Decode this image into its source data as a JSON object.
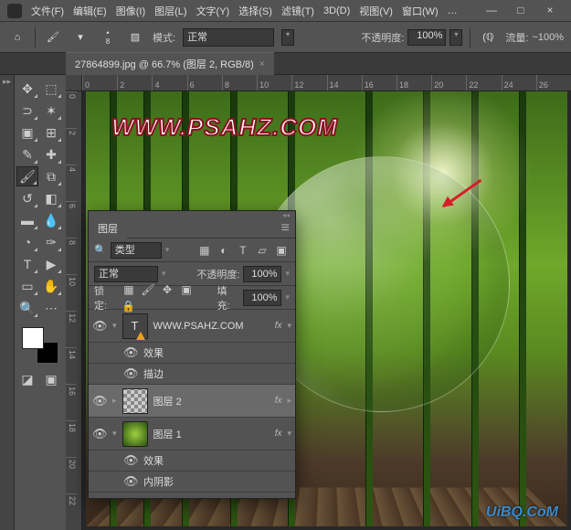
{
  "menu": {
    "file": "文件(F)",
    "edit": "编辑(E)",
    "image": "图像(I)",
    "layer": "图层(L)",
    "type": "文字(Y)",
    "select": "选择(S)",
    "filter": "滤镜(T)",
    "threeD": "3D(D)",
    "view": "视图(V)",
    "window": "窗口(W)",
    "help_truncated": "…"
  },
  "optbar": {
    "brush_size": "8",
    "mode_label": "模式:",
    "mode_value": "正常",
    "opacity_label": "不透明度:",
    "opacity_value": "100%",
    "flow_label": "流量:",
    "flow_value": "~100%"
  },
  "doc_tab": {
    "title": "27864899.jpg @ 66.7% (图层 2, RGB/8)",
    "close": "×"
  },
  "ruler_h": [
    "0",
    "2",
    "4",
    "6",
    "8",
    "10",
    "12",
    "14",
    "16",
    "18",
    "20",
    "22",
    "24",
    "26"
  ],
  "ruler_v": [
    "0",
    "2",
    "4",
    "6",
    "8",
    "10",
    "12",
    "14",
    "16",
    "18",
    "20",
    "22"
  ],
  "canvas": {
    "watermark": "WWW.PSAHZ.COM",
    "site": "UiBQ.CoM"
  },
  "layers_panel": {
    "title": "图层",
    "filter_label": "类型",
    "blend_mode": "正常",
    "opacity_label": "不透明度:",
    "opacity_value": "100%",
    "lock_label": "锁定:",
    "fill_label": "填充:",
    "fill_value": "100%",
    "items": [
      {
        "name": "WWW.PSAHZ.COM",
        "fx": "fx",
        "sub_effects": "效果",
        "sub_stroke": "描边"
      },
      {
        "name": "图层 2",
        "fx": "fx"
      },
      {
        "name": "图层 1",
        "fx": "fx",
        "sub_effects": "效果",
        "sub_inner": "内阴影"
      }
    ]
  }
}
